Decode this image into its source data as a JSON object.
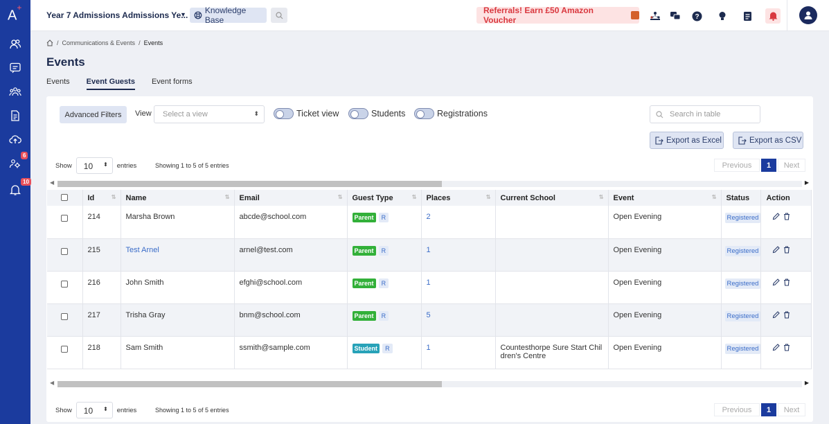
{
  "app": {
    "logo": "A",
    "logo_plus": "+"
  },
  "sidebar": {
    "items": [
      {
        "icon": "users-icon"
      },
      {
        "icon": "chat-icon"
      },
      {
        "icon": "group-icon"
      },
      {
        "icon": "document-icon"
      },
      {
        "icon": "cloud-upload-icon"
      },
      {
        "icon": "group-settings-icon",
        "badge": "6"
      },
      {
        "icon": "notification-bell-icon",
        "badge": "10"
      }
    ]
  },
  "topbar": {
    "title": "Year 7 Admissions Admissions Ye...",
    "knowledge_base": "Knowledge Base",
    "referral": "Referrals! Earn £50 Amazon Voucher"
  },
  "breadcrumb": {
    "parent": "Communications & Events",
    "current": "Events"
  },
  "page_title": "Events",
  "tabs": [
    {
      "label": "Events",
      "active": false
    },
    {
      "label": "Event Guests",
      "active": true
    },
    {
      "label": "Event forms",
      "active": false
    }
  ],
  "filters": {
    "advanced": "Advanced Filters",
    "view_label": "View",
    "view_placeholder": "Select a view",
    "toggles": [
      "Ticket view",
      "Students",
      "Registrations"
    ],
    "search_placeholder": "Search in table",
    "export_excel": "Export as Excel",
    "export_csv": "Export as CSV"
  },
  "pagination": {
    "show": "Show",
    "entries_value": "10",
    "entries": "entries",
    "info": "Showing 1 to 5 of 5 entries",
    "previous": "Previous",
    "page": "1",
    "next": "Next"
  },
  "table": {
    "headers": [
      "Id",
      "Name",
      "Email",
      "Guest Type",
      "Places",
      "Current School",
      "Event",
      "Status",
      "Action"
    ],
    "rows": [
      {
        "id": "214",
        "name": "Marsha Brown",
        "email": "abcde@school.com",
        "type": "Parent",
        "r": "R",
        "places": "2",
        "school": "",
        "school2": "",
        "event": "Open Evening",
        "status": "Registered"
      },
      {
        "id": "215",
        "name": "Test Arnel",
        "email": "arnel@test.com",
        "type": "Parent",
        "r": "R",
        "places": "1",
        "school": "",
        "school2": "",
        "event": "Open Evening",
        "status": "Registered"
      },
      {
        "id": "216",
        "name": "John Smith",
        "email": "efghi@school.com",
        "type": "Parent",
        "r": "R",
        "places": "1",
        "school": "",
        "school2": "",
        "event": "Open Evening",
        "status": "Registered"
      },
      {
        "id": "217",
        "name": "Trisha Gray",
        "email": "bnm@school.com",
        "type": "Parent",
        "r": "R",
        "places": "5",
        "school": "",
        "school2": "",
        "event": "Open Evening",
        "status": "Registered"
      },
      {
        "id": "218",
        "name": "Sam Smith",
        "email": "ssmith@sample.com",
        "type": "Student",
        "r": "R",
        "places": "1",
        "school": "Countesthorpe Sure Start Chil",
        "school2": "dren's Centre",
        "event": "Open Evening",
        "status": "Registered"
      }
    ]
  },
  "colors": {
    "rail": "#1b3b9e",
    "accent": "#1d2b4f",
    "parent_tag": "#32b039",
    "student_tag": "#27a2b8",
    "referral": "#d9383f"
  }
}
